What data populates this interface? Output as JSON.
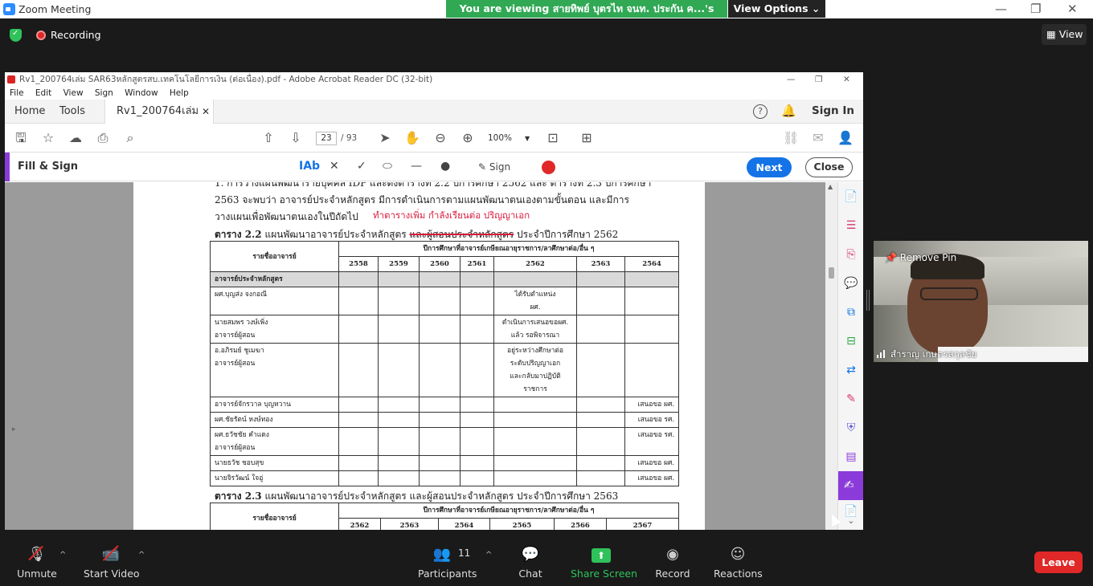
{
  "zoom": {
    "window_title": "Zoom Meeting",
    "share_banner": "You are viewing สายทิพย์ บุตรไท จนท. ประกัน ค...'s screen",
    "view_options": "View Options ⌄",
    "recording_label": "Recording",
    "view_label": "View",
    "bottom": {
      "unmute": "Unmute",
      "start_video": "Start Video",
      "participants": "Participants",
      "participants_count": "11",
      "chat": "Chat",
      "share_screen": "Share Screen",
      "record": "Record",
      "reactions": "Reactions",
      "leave": "Leave"
    },
    "video": {
      "remove_pin": "Remove Pin",
      "participant_name": "สำราญ เกษตรสกุลชัย"
    }
  },
  "acrobat": {
    "title": "Rv1_200764เล่ม SAR63หลักสูตรสบ.เทคโนโลยีการเงิน (ต่อเนื่อง).pdf - Adobe Acrobat Reader DC (32-bit)",
    "menu": [
      "File",
      "Edit",
      "View",
      "Sign",
      "Window",
      "Help"
    ],
    "tabs": {
      "home": "Home",
      "tools": "Tools",
      "doc": "Rv1_200764เล่ม SA..."
    },
    "sign_in": "Sign In",
    "page_current": "23",
    "page_total": "/ 93",
    "zoom": "100%",
    "fill_sign": {
      "title": "Fill & Sign",
      "sign": "Sign",
      "next": "Next",
      "close": "Close"
    }
  },
  "document": {
    "para_line1": "1. การวางแผนพัฒนารายบุคคล IDP และดังตารางที่ 2.2 ปีการศึกษา 2562 และ ตารางที่ 2.3 ปีการศึกษา",
    "para_line2": "2563 จะพบว่า อาจารย์ประจำหลักสูตร มีการดำเนินการตามแผนพัฒนาตนเองตามขั้นตอน และมีการ",
    "para_line3": "วางแผนเพื่อพัฒนาตนเองในปีถัดไป",
    "annotation": "ทำตารางเพิ่ม กำลังเรียนต่อ ปริญญาเอก",
    "table22_title_bold": "ตาราง 2.2",
    "table22_title_rest": "แผนพัฒนาอาจารย์ประจำหลักสูตร",
    "table22_title_strike": "และผู้สอนประจำหลักสูตร",
    "table22_title_end": "ประจำปีการศึกษา 2562",
    "table22": {
      "col_name": "รายชื่ออาจารย์",
      "col_group": "ปีการศึกษาที่อาจารย์เกษียณอายุราชการ/ลาศึกษาต่อ/อื่น ๆ",
      "years": [
        "2558",
        "2559",
        "2560",
        "2561",
        "2562",
        "2563",
        "2564"
      ],
      "section": "อาจารย์ประจำหลักสูตร",
      "rows": [
        {
          "name1": "ผศ.บุญส่ง จงกอณี",
          "name2": "",
          "c2562_1": "ได้รับตำแหน่ง",
          "c2562_2": "ผศ.",
          "c2562_3": "",
          "c2562_4": "",
          "c2564": ""
        },
        {
          "name1": "นายสมพร วงษ์เพิ่ง",
          "name2": "อาจารย์ผู้สอน",
          "c2562_1": "ดำเนินการเสนอขอผศ.",
          "c2562_2": "แล้ว รอพิจารณา",
          "c2562_3": "",
          "c2562_4": "",
          "c2564": ""
        },
        {
          "name1": "อ.อภิรมย์ ชูเมฆา",
          "name2": "อาจารย์ผู้สอน",
          "c2562_1": "อยู่ระหว่างศึกษาต่อ",
          "c2562_2": "ระดับปริญญาเอก",
          "c2562_3": "และกลับมาปฏิบัติ",
          "c2562_4": "ราชการ",
          "c2564": ""
        },
        {
          "name1": "อาจารย์จักรวาล บุญหวาน",
          "name2": "",
          "c2562_1": "",
          "c2562_2": "",
          "c2562_3": "",
          "c2562_4": "",
          "c2564": "เสนอขอ ผศ."
        },
        {
          "name1": "ผศ.ชัยรัตน์ หงษ์ทอง",
          "name2": "",
          "c2562_1": "",
          "c2562_2": "",
          "c2562_3": "",
          "c2562_4": "",
          "c2564": "เสนอขอ รศ."
        },
        {
          "name1": "ผศ.ธวัชชัย คำแดง",
          "name2": "อาจารย์ผู้สอน",
          "c2562_1": "",
          "c2562_2": "",
          "c2562_3": "",
          "c2562_4": "",
          "c2564": "เสนอขอ รศ."
        },
        {
          "name1": "นายธวัช ชอบสุข",
          "name2": "",
          "c2562_1": "",
          "c2562_2": "",
          "c2562_3": "",
          "c2562_4": "",
          "c2564": "เสนอขอ ผศ."
        },
        {
          "name1": "นายจิรวัฒน์ ใจอู่",
          "name2": "",
          "c2562_1": "",
          "c2562_2": "",
          "c2562_3": "",
          "c2562_4": "",
          "c2564": "เสนอขอ ผศ."
        }
      ]
    },
    "table23_title_bold": "ตาราง 2.3",
    "table23_title_rest": "แผนพัฒนาอาจารย์ประจำหลักสูตร และผู้สอนประจำหลักสูตร ประจำปีการศึกษา 2563",
    "table23": {
      "col_name": "รายชื่ออาจารย์",
      "col_group": "ปีการศึกษาที่อาจารย์เกษียณอายุราชการ/ลาศึกษาต่อ/อื่น ๆ",
      "years": [
        "2562",
        "2563",
        "2564",
        "2565",
        "2566",
        "2567"
      ]
    }
  }
}
